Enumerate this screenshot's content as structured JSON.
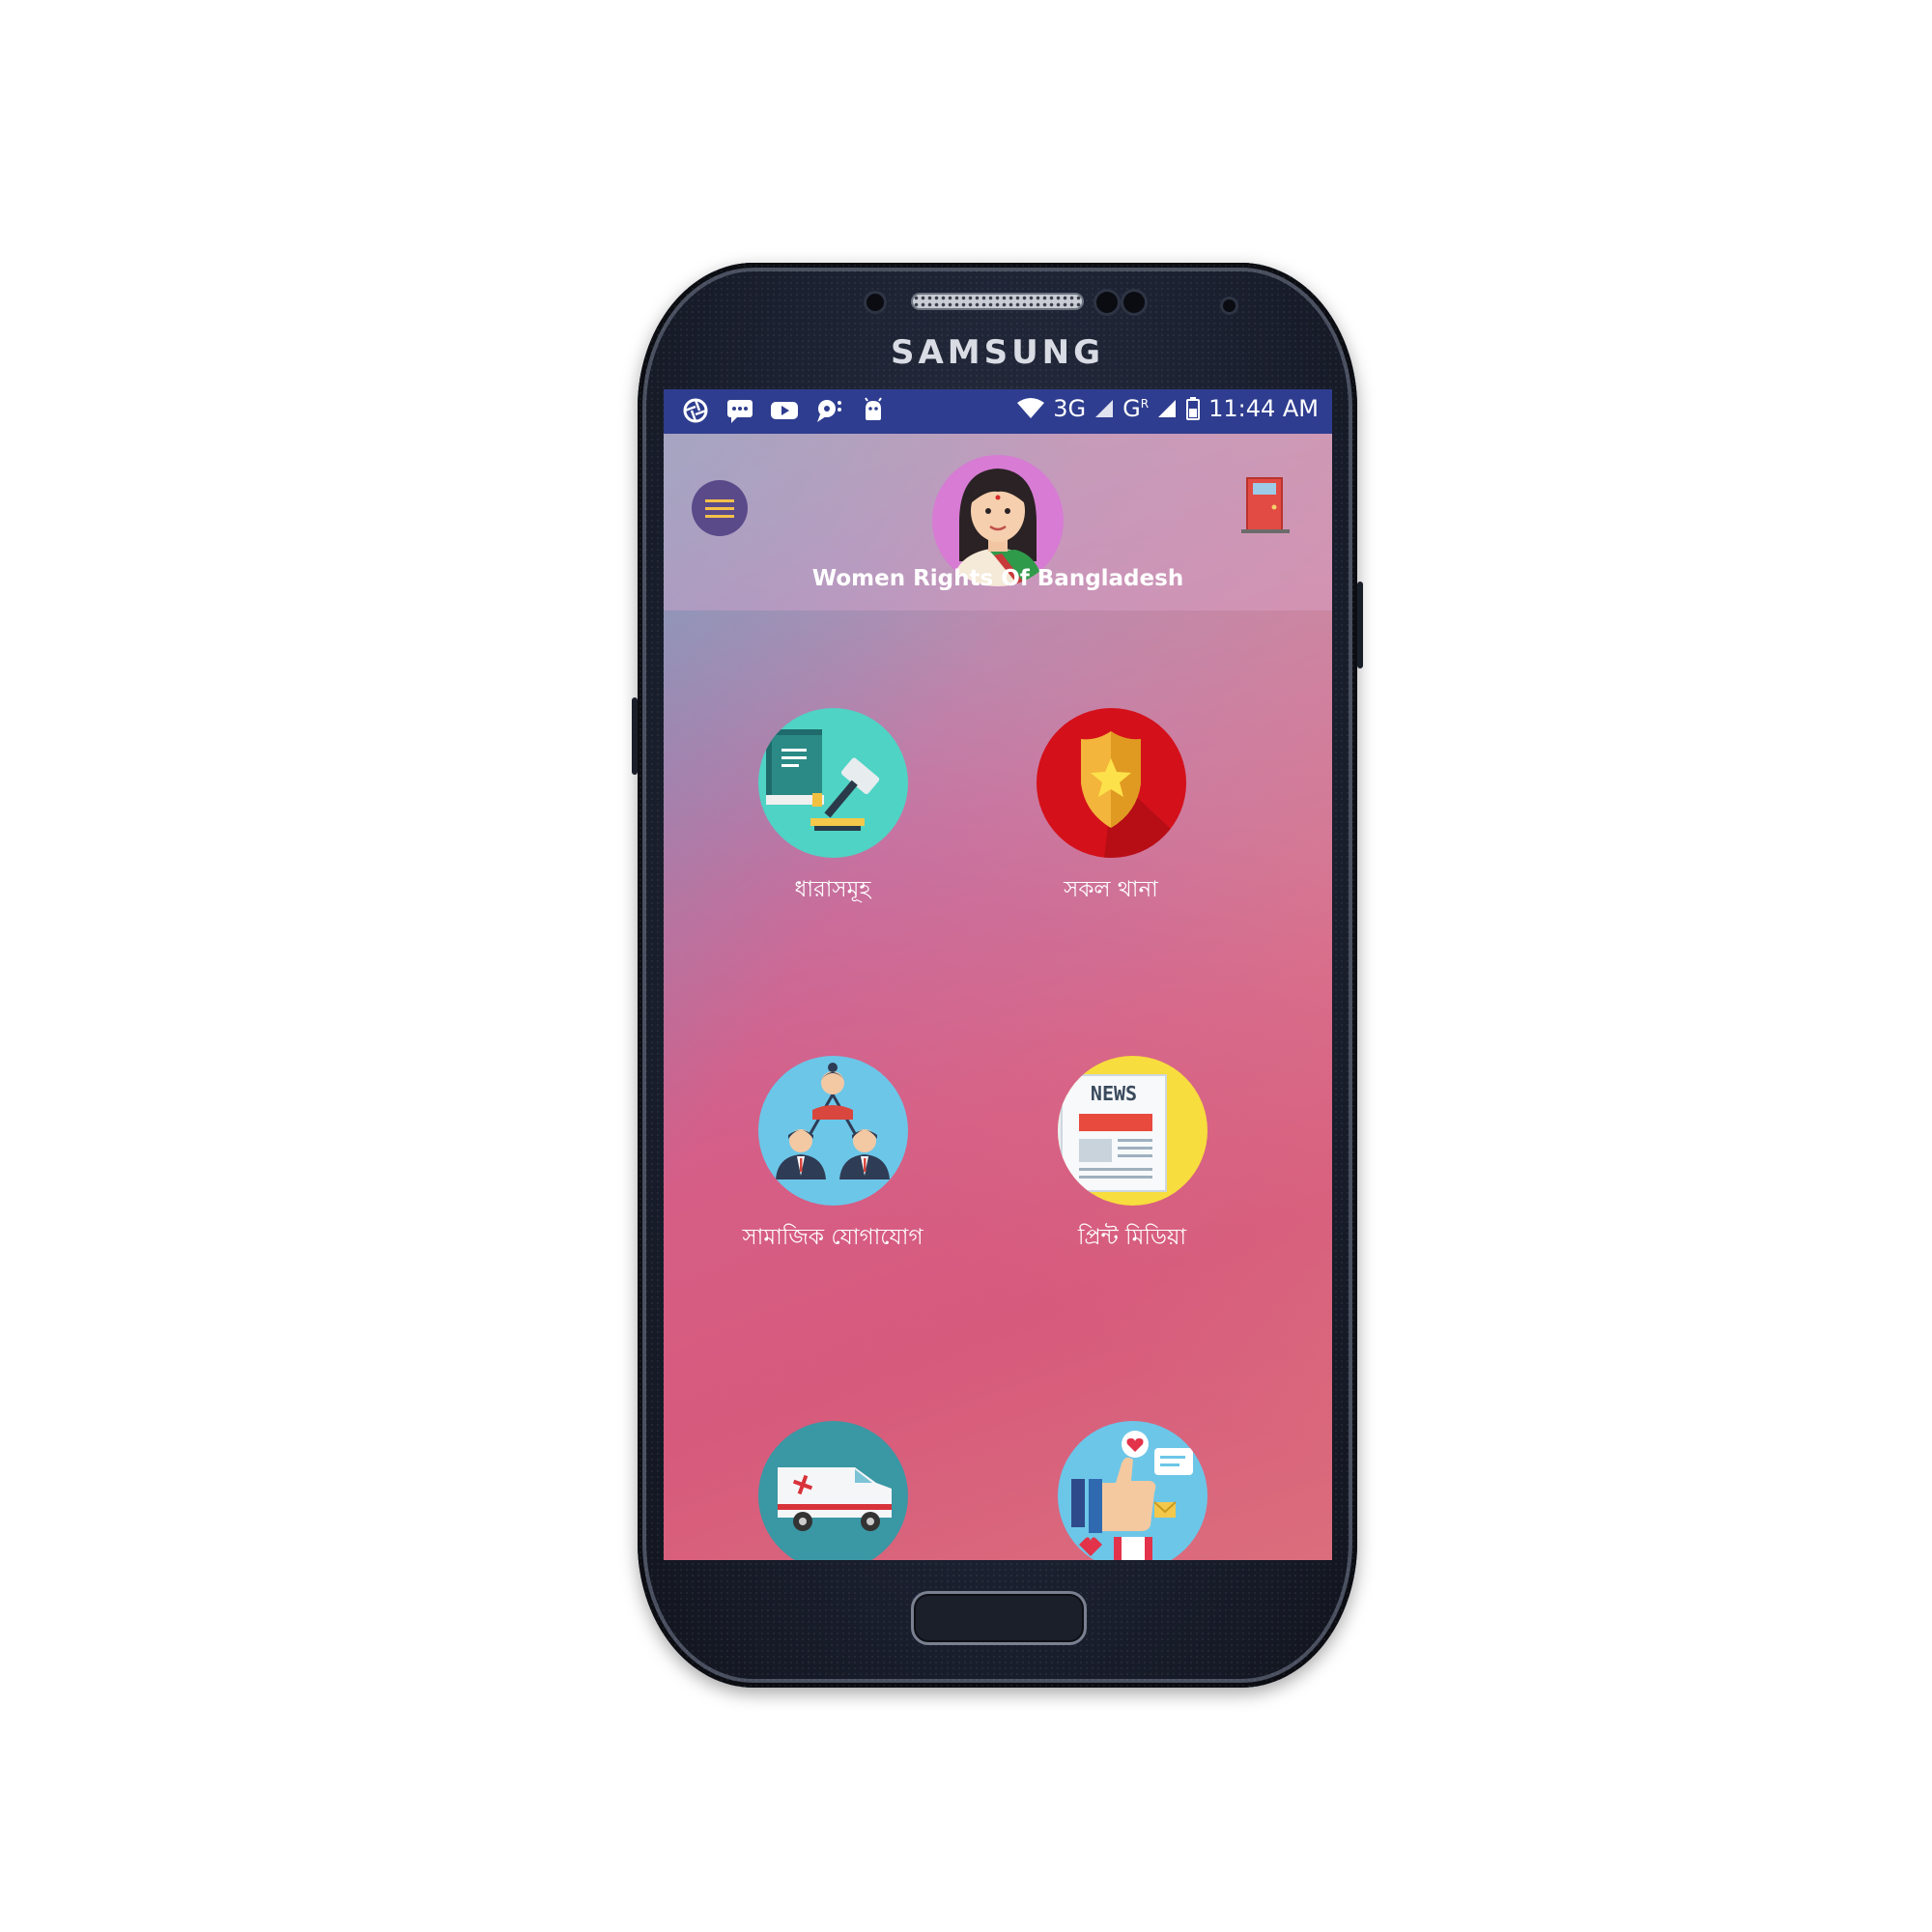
{
  "device": {
    "brand": "SAMSUNG"
  },
  "status_bar": {
    "icons": [
      "aperture-icon",
      "message-icon",
      "youtube-icon",
      "chat-icon",
      "android-icon"
    ],
    "network": "3G",
    "carrier": "G",
    "roaming": "R",
    "time": "11:44 AM",
    "background_color": "#2e3d8f"
  },
  "header": {
    "title": "Women Rights Of Bangladesh",
    "menu_icon": "hamburger-icon",
    "exit_icon": "exit-door-icon"
  },
  "menu": {
    "items": [
      {
        "label": "ধারাসমূহ",
        "icon": "law-book-gavel-icon",
        "color": "#4fd3c4"
      },
      {
        "label": "সকল থানা",
        "icon": "police-badge-icon",
        "color": "#d4101a"
      },
      {
        "label": "সামাজিক যোগাযোগ",
        "icon": "social-network-people-icon",
        "color": "#6cc6e8"
      },
      {
        "label": "প্রিন্ট মিডিয়া",
        "icon": "newspaper-icon",
        "color": "#f7dd3d"
      },
      {
        "label": "",
        "icon": "ambulance-icon",
        "color": "#3a97a4"
      },
      {
        "label": "",
        "icon": "feedback-thumbs-up-icon",
        "color": "#6cc6e8"
      }
    ]
  }
}
